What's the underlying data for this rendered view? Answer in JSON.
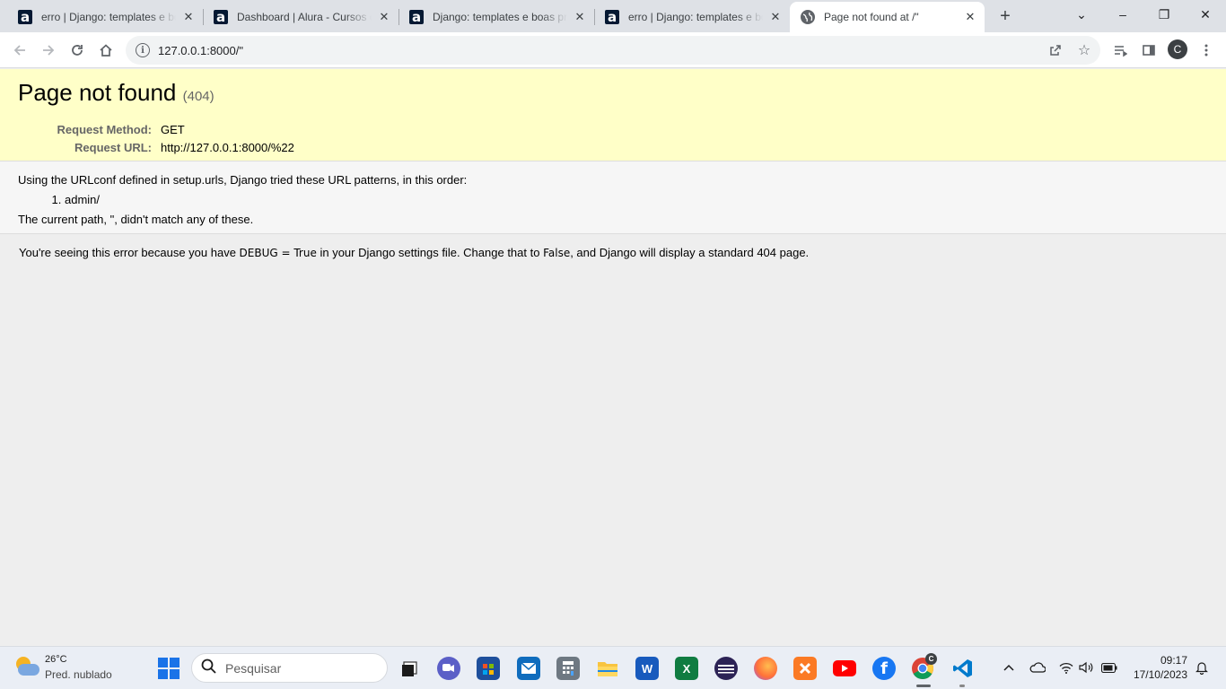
{
  "browser": {
    "tabs": [
      {
        "title": "erro | Django: templates e boas práticas",
        "favicon": "alura-icon",
        "active": false
      },
      {
        "title": "Dashboard | Alura - Cursos online",
        "favicon": "alura-icon",
        "active": false
      },
      {
        "title": "Django: templates e boas práticas",
        "favicon": "alura-icon",
        "active": false
      },
      {
        "title": "erro | Django: templates e boas práticas",
        "favicon": "alura-icon",
        "active": false
      },
      {
        "title": "Page not found at /\"",
        "favicon": "globe-icon",
        "active": true
      }
    ],
    "new_tab_icon": "+",
    "window_controls": {
      "dropdown": "⌄",
      "minimize": "–",
      "restore": "❐",
      "close": "✕"
    },
    "address": "127.0.0.1:8000/\"",
    "profile_initial": "C"
  },
  "page": {
    "title": "Page not found",
    "status": "(404)",
    "request_method_label": "Request Method:",
    "request_method": "GET",
    "request_url_label": "Request URL:",
    "request_url": "http://127.0.0.1:8000/%22",
    "urlconf_text": "Using the URLconf defined in setup.urls, Django tried these URL patterns, in this order:",
    "patterns": [
      "admin/"
    ],
    "current_path_text": "The current path, \", didn't match any of these.",
    "explanation_1": "You're seeing this error because you have ",
    "explanation_code_1": "DEBUG = True",
    "explanation_2": " in your Django settings file. Change that to ",
    "explanation_code_2": "False",
    "explanation_3": ", and Django will display a standard 404 page."
  },
  "taskbar": {
    "weather_temp": "26°C",
    "weather_desc": "Pred. nublado",
    "search_placeholder": "Pesquisar",
    "chrome_badge": "C",
    "time": "09:17",
    "date": "17/10/2023"
  },
  "colors": {
    "summary_bg": "#ffffc8",
    "info_bg": "#f6f6f6",
    "page_bg": "#eeeeee",
    "tabstrip_bg": "#dee1e6",
    "taskbar_bg": "#eaeef5"
  }
}
